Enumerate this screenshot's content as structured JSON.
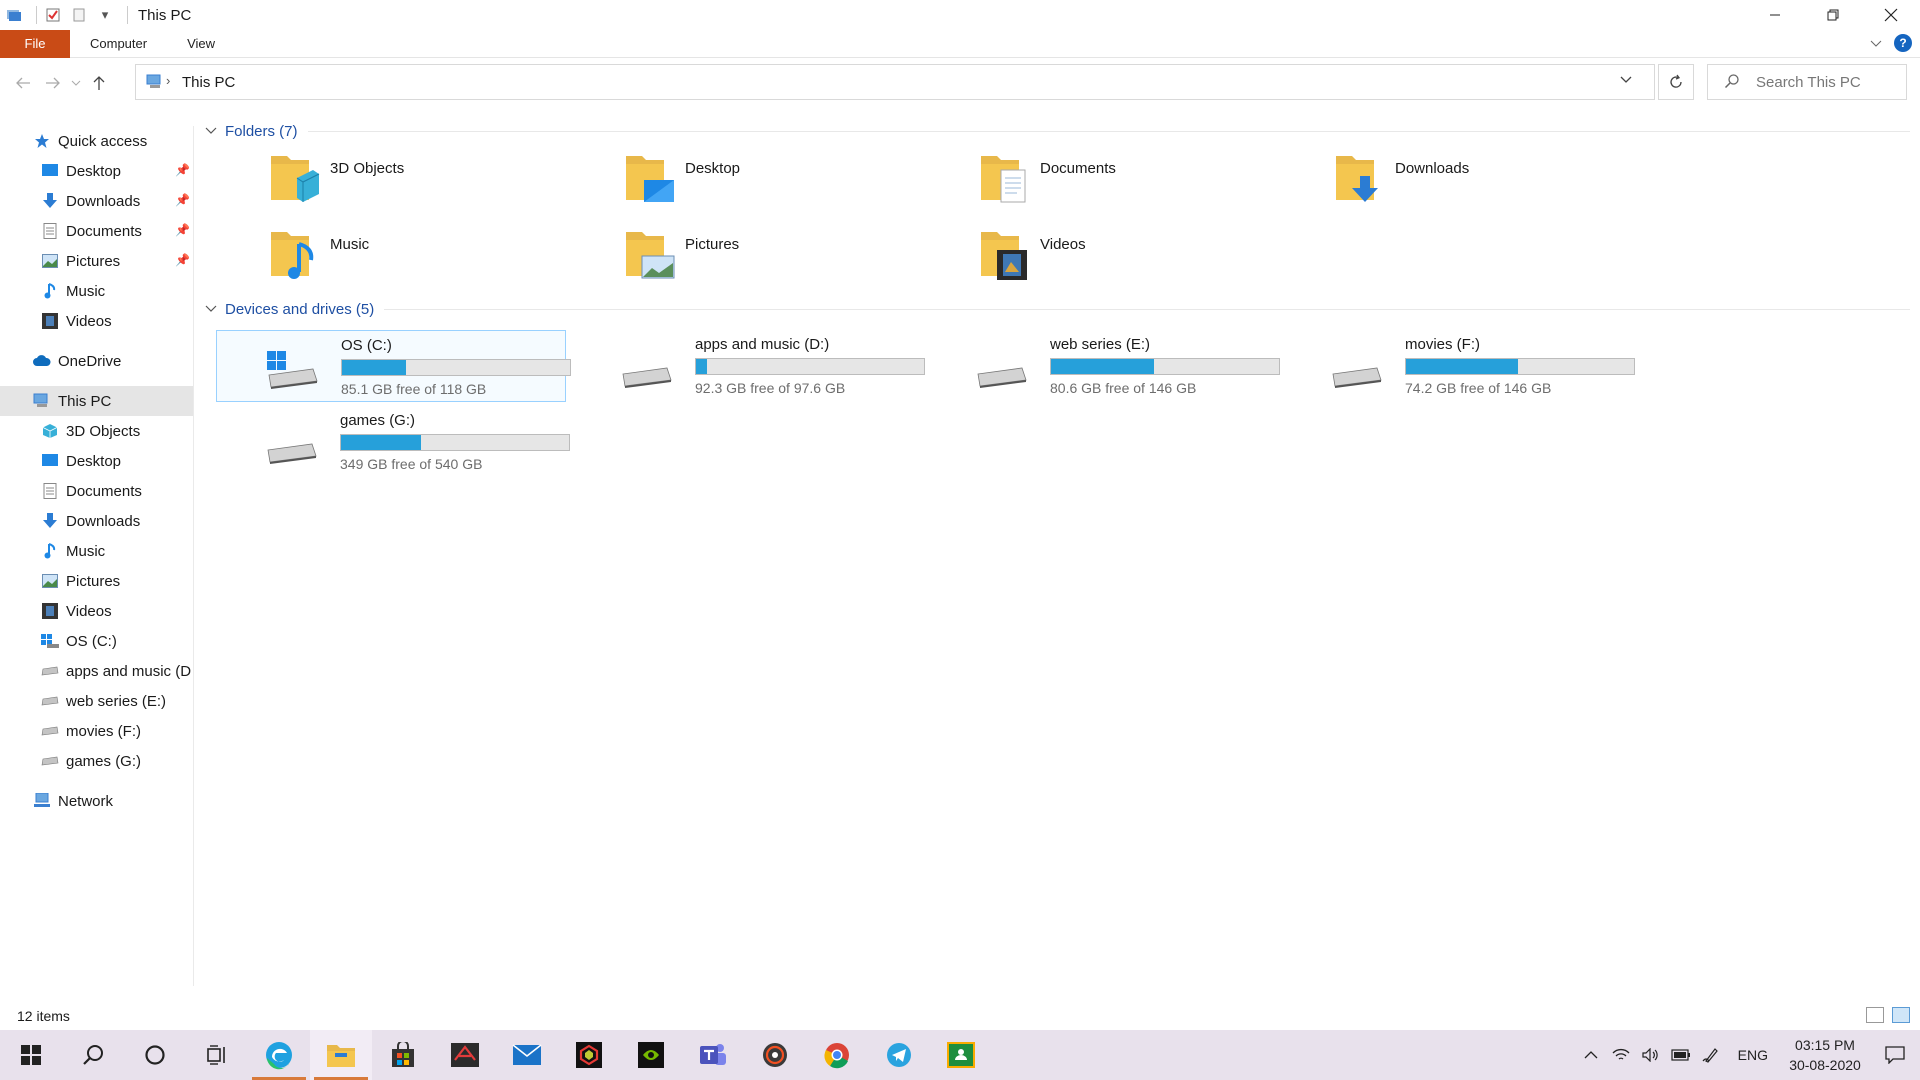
{
  "window": {
    "title": "This PC",
    "qat_dropdown": "▾"
  },
  "ribbon": {
    "tabs": [
      "File",
      "Computer",
      "View"
    ]
  },
  "address": {
    "crumb": "This PC",
    "search_placeholder": "Search This PC"
  },
  "sidebar": {
    "quick_access": {
      "label": "Quick access",
      "items": [
        {
          "label": "Desktop",
          "pinned": true
        },
        {
          "label": "Downloads",
          "pinned": true
        },
        {
          "label": "Documents",
          "pinned": true
        },
        {
          "label": "Pictures",
          "pinned": true
        },
        {
          "label": "Music",
          "pinned": false
        },
        {
          "label": "Videos",
          "pinned": false
        }
      ]
    },
    "onedrive": "OneDrive",
    "this_pc": {
      "label": "This PC",
      "items": [
        "3D Objects",
        "Desktop",
        "Documents",
        "Downloads",
        "Music",
        "Pictures",
        "Videos",
        "OS (C:)",
        "apps and music  (D",
        "web series (E:)",
        "movies (F:)",
        "games (G:)"
      ]
    },
    "network": "Network"
  },
  "main": {
    "folders_header": "Folders (7)",
    "folders": [
      "3D Objects",
      "Desktop",
      "Documents",
      "Downloads",
      "Music",
      "Pictures",
      "Videos"
    ],
    "drives_header": "Devices and drives (5)",
    "drives": [
      {
        "name": "OS (C:)",
        "free": "85.1 GB free of 118 GB",
        "used_fraction": 0.28
      },
      {
        "name": "apps and music  (D:)",
        "free": "92.3 GB free of 97.6 GB",
        "used_fraction": 0.05
      },
      {
        "name": "web series (E:)",
        "free": "80.6 GB free of 146 GB",
        "used_fraction": 0.45
      },
      {
        "name": "movies (F:)",
        "free": "74.2 GB free of 146 GB",
        "used_fraction": 0.49
      },
      {
        "name": "games (G:)",
        "free": "349 GB free of 540 GB",
        "used_fraction": 0.35
      }
    ]
  },
  "status": {
    "items_count": "12 items"
  },
  "taskbar": {
    "lang": "ENG",
    "time": "03:15 PM",
    "date": "30-08-2020"
  },
  "colors": {
    "accent_file_tab": "#c94b16",
    "drive_bar_fill": "#26a0da",
    "folder_yellow": "#f4c64f",
    "group_header": "#1e4fa3"
  }
}
